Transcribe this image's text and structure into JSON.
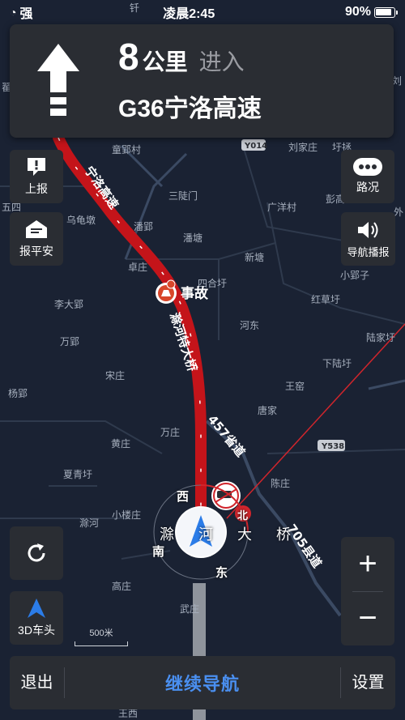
{
  "status_bar": {
    "signal": "强",
    "time": "凌晨2:45",
    "battery": "90%",
    "battery_level": 0.9
  },
  "guide": {
    "distance": "8",
    "unit": "公里",
    "action": "进入",
    "road": "G36宁洛高速"
  },
  "left_buttons": {
    "report": "上报",
    "safety": "报平安",
    "view3d": "3D车头"
  },
  "right_buttons": {
    "traffic": "路况",
    "voice": "导航播报"
  },
  "map": {
    "places": [
      "童郢村",
      "三陡门",
      "潘郢",
      "卓庄",
      "潘塘",
      "四合圩",
      "新塘",
      "广洋村",
      "刘家庄",
      "圩拯",
      "彭高",
      "乌龟墩",
      "李大郢",
      "小郢子",
      "红草圩",
      "万郢",
      "河东",
      "陆家圩",
      "宋庄",
      "下陆圩",
      "王窑",
      "杨郢",
      "唐家",
      "万庄",
      "黄庄",
      "夏青圩",
      "陈庄",
      "小楼庄",
      "滁河",
      "高庄",
      "武庄",
      "五四",
      "外",
      "翟",
      "王西",
      "钎",
      "刘"
    ],
    "incident": "事故",
    "road_labels": [
      "宁洛高速",
      "滁河特大桥",
      "457省道",
      "705县道",
      "滁河大桥"
    ],
    "shields": [
      "Y014",
      "Y538"
    ],
    "compass": {
      "west": "西",
      "north": "北",
      "south": "南",
      "east": "东"
    },
    "scale": "500米"
  },
  "zoom": {
    "in": "+",
    "out": "−"
  },
  "bottom": {
    "exit": "退出",
    "continue": "继续导航",
    "settings": "设置"
  },
  "colors": {
    "route": "#c4141a",
    "accent": "#4a8ff0",
    "panel": "#2a2d33",
    "map_bg": "#1a2233"
  }
}
